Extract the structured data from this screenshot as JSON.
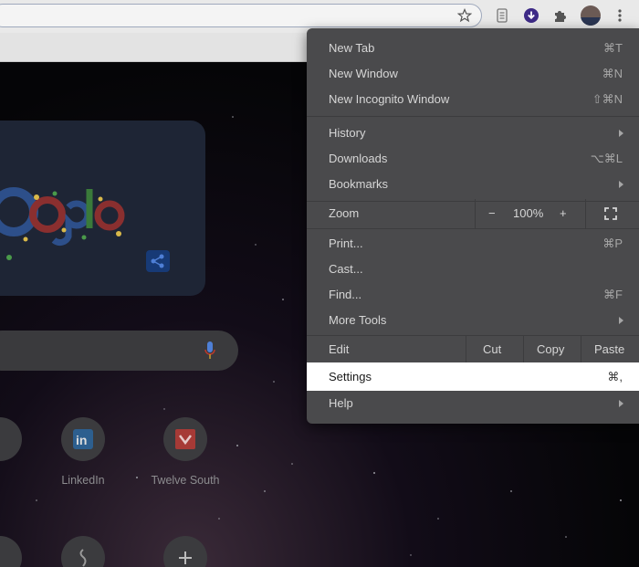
{
  "menu": {
    "items": [
      {
        "label": "New Tab",
        "shortcut": "⌘T"
      },
      {
        "label": "New Window",
        "shortcut": "⌘N"
      },
      {
        "label": "New Incognito Window",
        "shortcut": "⇧⌘N"
      },
      {
        "label": "History",
        "shortcut": ""
      },
      {
        "label": "Downloads",
        "shortcut": "⌥⌘L"
      },
      {
        "label": "Bookmarks",
        "shortcut": ""
      },
      {
        "label": "Print...",
        "shortcut": "⌘P"
      },
      {
        "label": "Cast...",
        "shortcut": ""
      },
      {
        "label": "Find...",
        "shortcut": "⌘F"
      },
      {
        "label": "More Tools",
        "shortcut": ""
      },
      {
        "label": "Settings",
        "shortcut": "⌘,"
      },
      {
        "label": "Help",
        "shortcut": ""
      }
    ],
    "zoom": {
      "label": "Zoom",
      "minus": "−",
      "value": "100%",
      "plus": "+"
    },
    "edit": {
      "label": "Edit",
      "cut": "Cut",
      "copy": "Copy",
      "paste": "Paste"
    },
    "highlighted": "Settings"
  },
  "shortcuts": [
    {
      "label": "LinkedIn",
      "icon": "linkedin-icon"
    },
    {
      "label": "Twelve South",
      "icon": "twelve-south-icon"
    }
  ],
  "colors": {
    "menu_bg": "#4a4a4c",
    "highlight_bg": "#ffffff",
    "toolbar_bg": "#e9e9e9"
  }
}
